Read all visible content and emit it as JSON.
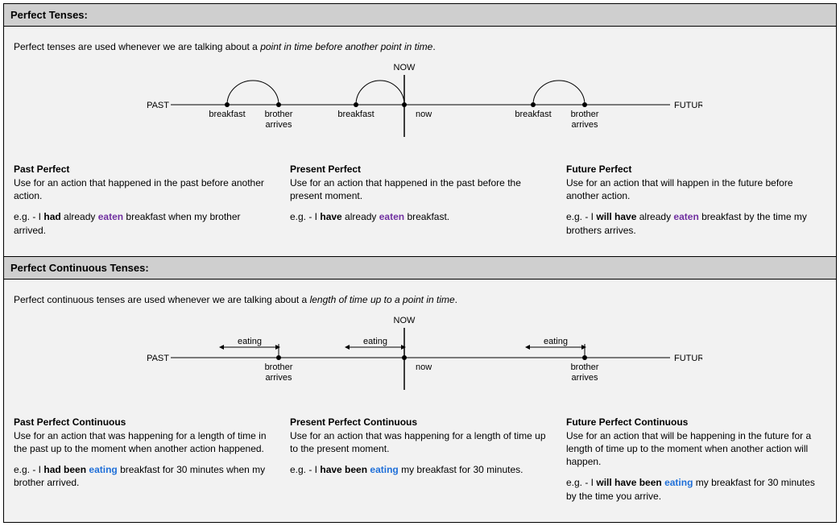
{
  "perfect": {
    "header": "Perfect Tenses:",
    "intro_a": "Perfect tenses are used whenever we are talking about a ",
    "intro_b": "point in time before another point in time",
    "intro_c": ".",
    "diagram": {
      "past": "PAST",
      "future": "FUTURE",
      "now": "NOW",
      "p1a": "breakfast",
      "p1b_l1": "brother",
      "p1b_l2": "arrives",
      "p2a": "breakfast",
      "p2b": "now",
      "p3a": "breakfast",
      "p3b_l1": "brother",
      "p3b_l2": "arrives"
    },
    "col1": {
      "title": "Past Perfect",
      "desc": "Use for an action that happened in the past before another action.",
      "ex_pre": "e.g. - I ",
      "ex_b1": "had",
      "ex_mid": " already ",
      "ex_pp": "eaten",
      "ex_post": " breakfast when my brother arrived."
    },
    "col2": {
      "title": "Present Perfect",
      "desc": "Use for an action that happened in the past before the present moment.",
      "ex_pre": "e.g. - I ",
      "ex_b1": "have",
      "ex_mid": " already ",
      "ex_pp": "eaten",
      "ex_post": " breakfast."
    },
    "col3": {
      "title": "Future Perfect",
      "desc": "Use for an action that will happen in the future before another action.",
      "ex_pre": "e.g. - I ",
      "ex_b1": "will have",
      "ex_mid": " already ",
      "ex_pp": "eaten",
      "ex_post": " breakfast by the time my brothers arrives."
    }
  },
  "perfectcont": {
    "header": "Perfect Continuous Tenses:",
    "intro_a": "Perfect continuous tenses are used whenever we are talking about a ",
    "intro_b": "length of time up to a point in time",
    "intro_c": ".",
    "diagram": {
      "past": "PAST",
      "future": "FUTURE",
      "now": "NOW",
      "eat": "eating",
      "p1b_l1": "brother",
      "p1b_l2": "arrives",
      "p2b": "now",
      "p3b_l1": "brother",
      "p3b_l2": "arrives"
    },
    "col1": {
      "title": "Past Perfect Continuous",
      "desc": "Use for an action that was happening for a length of time in the past up to the moment when another action happened.",
      "ex_pre": "e.g. - I ",
      "ex_b1": "had been",
      "ex_sp": " ",
      "ex_pp": "eating",
      "ex_post": " breakfast for 30 minutes when my brother arrived."
    },
    "col2": {
      "title": "Present Perfect Continuous",
      "desc": "Use for an action that was happening for a length of time up to the present moment.",
      "ex_pre": "e.g. - I ",
      "ex_b1": "have been",
      "ex_sp": " ",
      "ex_pp": "eating",
      "ex_post": " my breakfast for 30 minutes."
    },
    "col3": {
      "title": "Future Perfect Continuous",
      "desc": "Use for an action that will be happening in the future for a length of time up to the moment when another action will happen.",
      "ex_pre": "e.g. - I ",
      "ex_b1": "will have been",
      "ex_sp": " ",
      "ex_pp": "eating",
      "ex_post": " my breakfast for 30 minutes by the time you arrive."
    }
  }
}
